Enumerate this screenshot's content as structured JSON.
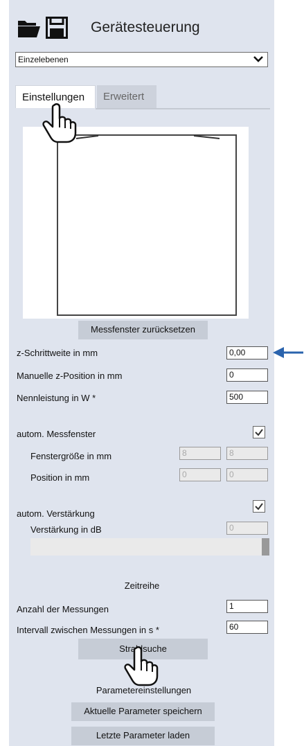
{
  "header": {
    "title": "Gerätesteuerung",
    "folder_icon": "folder-icon",
    "save_icon": "save-icon"
  },
  "mode_select": {
    "value": "Einzelebenen"
  },
  "tabs": [
    {
      "label": "Einstellungen",
      "active": true
    },
    {
      "label": "Erweitert",
      "active": false
    }
  ],
  "preview": {
    "reset_button": "Messfenster zurücksetzen"
  },
  "fields": {
    "z_step": {
      "label": "z-Schrittweite in mm",
      "value": "0,00"
    },
    "z_pos": {
      "label": "Manuelle z-Position in mm",
      "value": "0"
    },
    "power": {
      "label": "Nennleistung in W *",
      "value": "500"
    }
  },
  "auto_window": {
    "label": "autom. Messfenster",
    "checked": true,
    "size_label": "Fenstergröße in mm",
    "size_x": "8",
    "size_y": "8",
    "pos_label": "Position in mm",
    "pos_x": "0",
    "pos_y": "0"
  },
  "auto_gain": {
    "label": "autom. Verstärkung",
    "checked": true,
    "gain_label": "Verstärkung in dB",
    "gain_value": "0"
  },
  "time_series": {
    "heading": "Zeitreihe",
    "count_label": "Anzahl der Messungen",
    "count_value": "1",
    "interval_label": "Intervall zwischen Messungen in s *",
    "interval_value": "60",
    "beam_button": "Strahlsuche"
  },
  "params": {
    "heading": "Parametereinstellungen",
    "save_button": "Aktuelle Parameter speichern",
    "load_button": "Letzte Parameter laden"
  },
  "colors": {
    "panel": "#dfe4ee",
    "button": "#c6ccd6",
    "arrow": "#2a63ad"
  }
}
